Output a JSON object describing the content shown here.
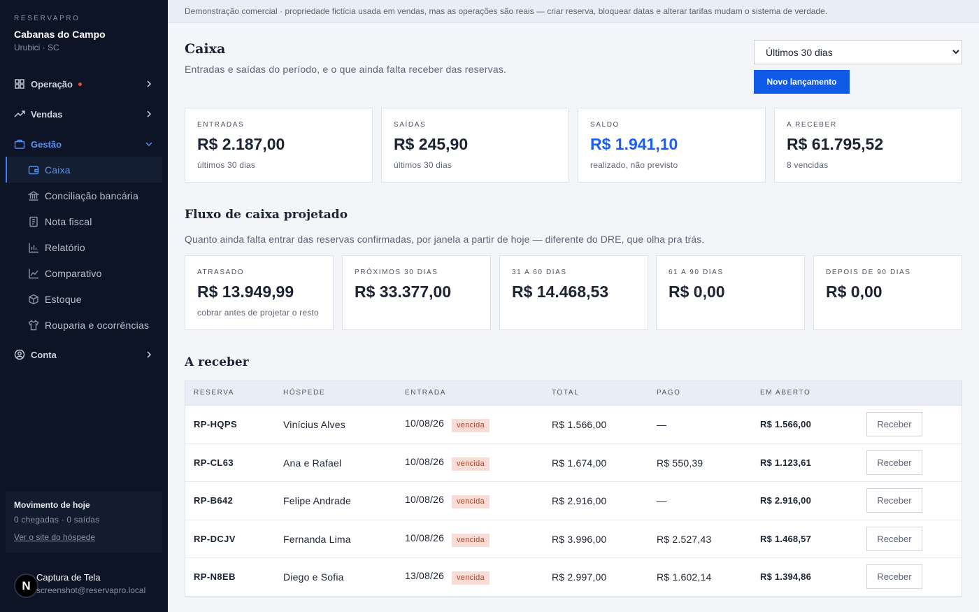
{
  "brand": {
    "kicker": "RESERVAPRO",
    "name": "Cabanas do Campo",
    "location": "Urubici · SC"
  },
  "nav": {
    "operacao": "Operação",
    "vendas": "Vendas",
    "gestao": "Gestão",
    "conta": "Conta",
    "items": [
      "Caixa",
      "Conciliação bancária",
      "Nota fiscal",
      "Relatório",
      "Comparativo",
      "Estoque",
      "Rouparia e ocorrências"
    ]
  },
  "today": {
    "title": "Movimento de hoje",
    "stats": "0 chegadas · 0 saídas",
    "link": "Ver o site do hóspede"
  },
  "user": {
    "initial": "N",
    "name": "Captura de Tela",
    "email": "screenshot@reservapro.local"
  },
  "banner": "Demonstração comercial · propriedade fictícia usada em vendas, mas as operações são reais — criar reserva, bloquear datas e alterar tarifas mudam o sistema de verdade.",
  "header": {
    "title": "Caixa",
    "subtitle": "Entradas e saídas do período, e o que ainda falta receber das reservas.",
    "period": "Últimos 30 dias",
    "new_button": "Novo lançamento"
  },
  "kpis": [
    {
      "label": "ENTRADAS",
      "value": "R$ 2.187,00",
      "note": "últimos 30 dias"
    },
    {
      "label": "SAÍDAS",
      "value": "R$ 245,90",
      "note": "últimos 30 dias"
    },
    {
      "label": "SALDO",
      "value": "R$ 1.941,10",
      "note": "realizado, não previsto"
    },
    {
      "label": "A RECEBER",
      "value": "R$ 61.795,52",
      "note": "8 vencidas"
    }
  ],
  "projection": {
    "title": "Fluxo de caixa projetado",
    "subtitle": "Quanto ainda falta entrar das reservas confirmadas, por janela a partir de hoje — diferente do DRE, que olha pra trás.",
    "cards": [
      {
        "label": "ATRASADO",
        "value": "R$ 13.949,99",
        "note": "cobrar antes de projetar o resto"
      },
      {
        "label": "PRÓXIMOS 30 DIAS",
        "value": "R$ 33.377,00"
      },
      {
        "label": "31 A 60 DIAS",
        "value": "R$ 14.468,53"
      },
      {
        "label": "61 A 90 DIAS",
        "value": "R$ 0,00"
      },
      {
        "label": "DEPOIS DE 90 DIAS",
        "value": "R$ 0,00"
      }
    ]
  },
  "receivables": {
    "title": "A receber",
    "columns": [
      "RESERVA",
      "HÓSPEDE",
      "ENTRADA",
      "TOTAL",
      "PAGO",
      "EM ABERTO"
    ],
    "action_label": "Receber",
    "rows": [
      {
        "code": "RP-HQPS",
        "guest": "Vinícius Alves",
        "date": "10/08/26",
        "status": "vencida",
        "total": "R$ 1.566,00",
        "paid": "—",
        "open": "R$ 1.566,00"
      },
      {
        "code": "RP-CL63",
        "guest": "Ana e Rafael",
        "date": "10/08/26",
        "status": "vencida",
        "total": "R$ 1.674,00",
        "paid": "R$ 550,39",
        "open": "R$ 1.123,61"
      },
      {
        "code": "RP-B642",
        "guest": "Felipe Andrade",
        "date": "10/08/26",
        "status": "vencida",
        "total": "R$ 2.916,00",
        "paid": "—",
        "open": "R$ 2.916,00"
      },
      {
        "code": "RP-DCJV",
        "guest": "Fernanda Lima",
        "date": "10/08/26",
        "status": "vencida",
        "total": "R$ 3.996,00",
        "paid": "R$ 2.527,43",
        "open": "R$ 1.468,57"
      },
      {
        "code": "RP-N8EB",
        "guest": "Diego e Sofia",
        "date": "13/08/26",
        "status": "vencida",
        "total": "R$ 2.997,00",
        "paid": "R$ 1.602,14",
        "open": "R$ 1.394,86"
      }
    ]
  },
  "colors": {
    "accent": "#0f5be8",
    "sidebar_bg": "#0c1425",
    "active_nav": "#5b8ff0",
    "overdue_bg": "#f9dcd5",
    "overdue_text": "#b2432b",
    "alert_dot": "#d9553b"
  }
}
